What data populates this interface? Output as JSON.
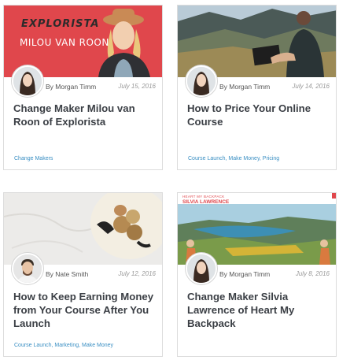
{
  "cards": [
    {
      "hero_caption": [
        "EXPLORISTA",
        "MILOU VAN ROON"
      ],
      "author": "By Morgan Timm",
      "date": "July 15, 2016",
      "title": "Change Maker Milou van Roon of Explorista",
      "tags": "Change Makers"
    },
    {
      "author": "By Morgan Timm",
      "date": "July 14, 2016",
      "title": "How to Price Your Online Course",
      "tags": "Course Launch, Make Money, Pricing"
    },
    {
      "author": "By Nate Smith",
      "date": "July 12, 2016",
      "title": "How to Keep Earning Money from Your Course After You Launch",
      "tags": "Course Launch, Marketing, Make Money"
    },
    {
      "hero_caption": [
        "HEART MY BACKPACK",
        "SILVIA LAWRENCE"
      ],
      "author": "By Morgan Timm",
      "date": "July 8, 2016",
      "title": "Change Maker Silvia Lawrence of Heart My Backpack",
      "tags": ""
    }
  ],
  "colors": {
    "tag_link": "#3a8fc3",
    "title": "#3b3f45",
    "hero_red": "#e0474c"
  }
}
